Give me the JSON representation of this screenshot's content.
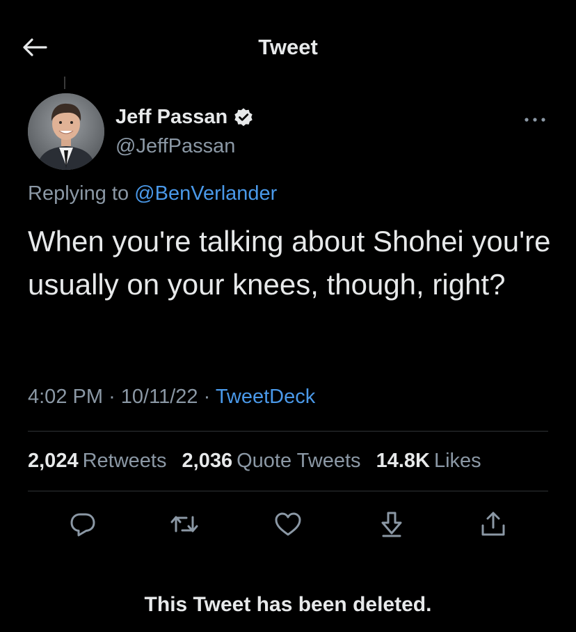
{
  "header": {
    "title": "Tweet",
    "back_icon": "back-arrow-icon"
  },
  "author": {
    "name": "Jeff Passan",
    "handle": "@JeffPassan",
    "verified": true
  },
  "tweet": {
    "replying_prefix": "Replying to ",
    "replying_to": "@BenVerlander",
    "text": "When you're talking about Shohei you're usually on your knees, though, right?",
    "time": "4:02 PM",
    "separator": "·",
    "date": "10/11/22",
    "source": "TweetDeck"
  },
  "stats": {
    "retweets_count": "2,024",
    "retweets_label": "Retweets",
    "quotes_count": "2,036",
    "quotes_label": "Quote Tweets",
    "likes_count": "14.8K",
    "likes_label": "Likes"
  },
  "actions": [
    "reply-icon",
    "retweet-icon",
    "like-icon",
    "bookmark-icon",
    "share-icon"
  ],
  "footer": {
    "deleted_notice": "This Tweet has been deleted."
  },
  "colors": {
    "background": "#000000",
    "text": "#e7e9ea",
    "secondary": "#8b98a5",
    "link": "#4a99e9",
    "divider": "#2f3336"
  }
}
